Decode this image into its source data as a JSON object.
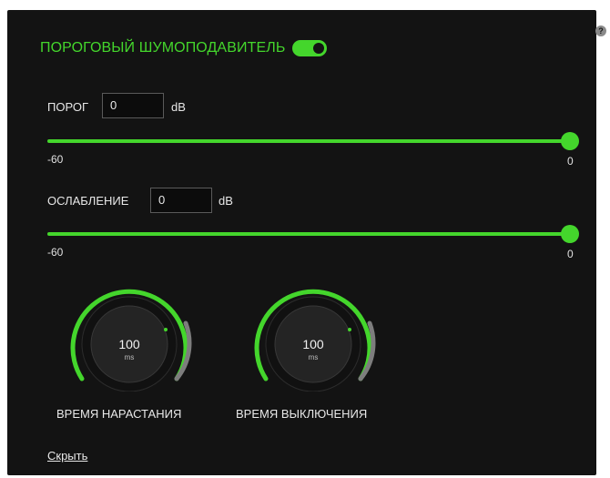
{
  "header": {
    "title": "ПОРОГОВЫЙ ШУМОПОДАВИТЕЛЬ",
    "toggle_on": true
  },
  "threshold": {
    "label": "ПОРОГ",
    "value": "0",
    "unit": "dB",
    "slider_min_label": "-60",
    "slider_max_label": "0",
    "slider_fraction": 1.0
  },
  "attenuation": {
    "label": "ОСЛАБЛЕНИЕ",
    "value": "0",
    "unit": "dB",
    "slider_min_label": "-60",
    "slider_max_label": "0",
    "slider_fraction": 1.0
  },
  "knobs": {
    "attack": {
      "value": "100",
      "unit": "ms",
      "label": "ВРЕМЯ НАРАСТАНИЯ"
    },
    "release": {
      "value": "100",
      "unit": "ms",
      "label": "ВРЕМЯ ВЫКЛЮЧЕНИЯ"
    }
  },
  "footer": {
    "hide_link": "Скрыть"
  },
  "colors": {
    "accent": "#44d62c",
    "panel": "#131313",
    "text": "#e8e8e8"
  },
  "icons": {
    "help": "help-icon",
    "help_glyph": "?"
  }
}
